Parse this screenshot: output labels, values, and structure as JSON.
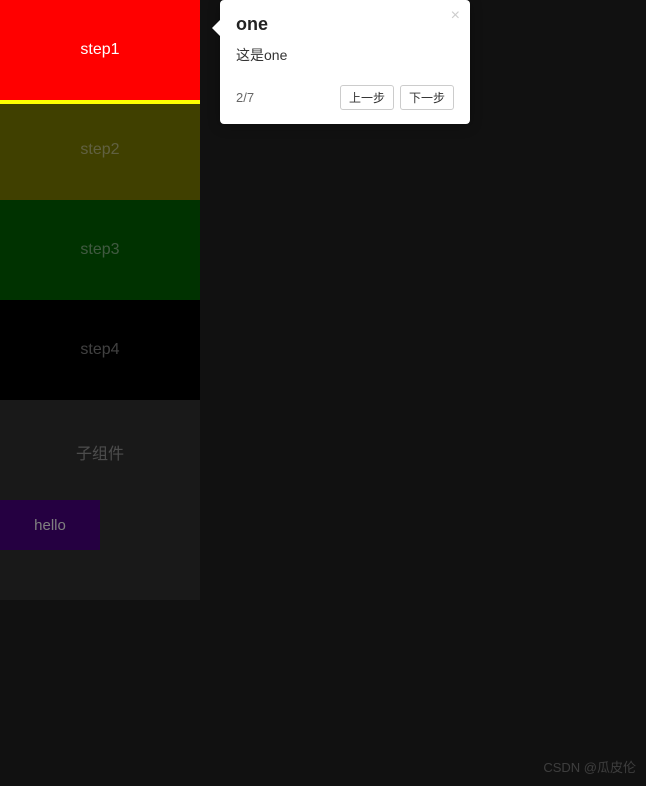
{
  "sidebar": {
    "items": [
      {
        "label": "step1",
        "color": "#ff0000"
      },
      {
        "label": "step2",
        "color": "#808000"
      },
      {
        "label": "step3",
        "color": "#006400"
      },
      {
        "label": "step4",
        "color": "#000000"
      },
      {
        "label": "子组件",
        "color": "#333333"
      }
    ],
    "hello_label": "hello"
  },
  "tooltip": {
    "title": "one",
    "content": "这是one",
    "counter": "2/7",
    "prev_label": "上一步",
    "next_label": "下一步",
    "close_symbol": "×"
  },
  "watermark": "CSDN @瓜皮伦"
}
